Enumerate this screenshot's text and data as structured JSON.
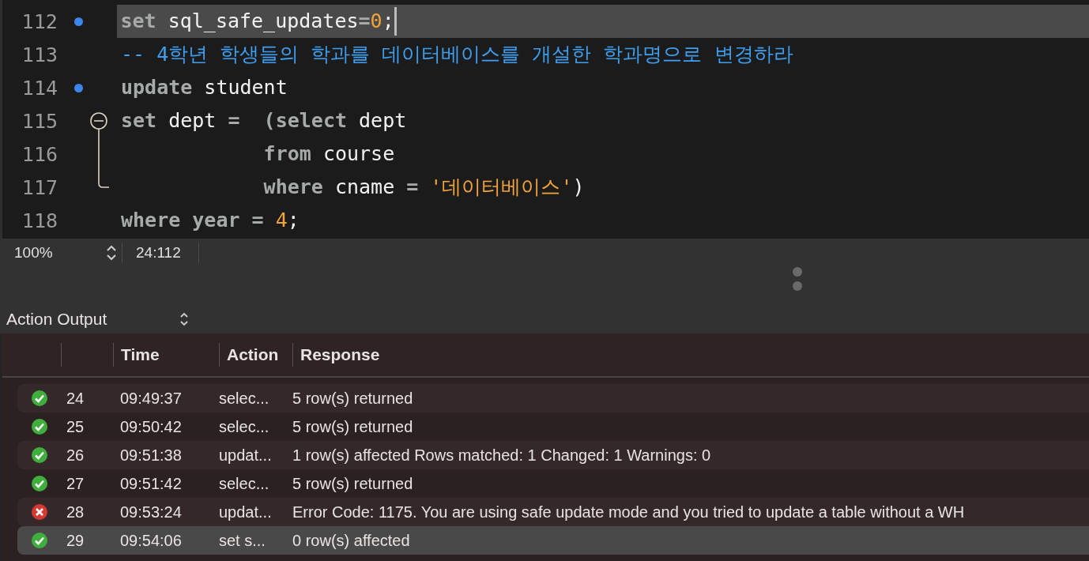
{
  "editor": {
    "lines": [
      {
        "number": "112",
        "bookmark": true,
        "highlighted": true,
        "tokens": [
          {
            "kind": "keyword",
            "text": "set"
          },
          {
            "kind": "plain",
            "text": " sql_safe_updates"
          },
          {
            "kind": "keyword",
            "text": "="
          },
          {
            "kind": "number",
            "text": "0"
          },
          {
            "kind": "plain",
            "text": ";"
          }
        ]
      },
      {
        "number": "113",
        "bookmark": false,
        "highlighted": false,
        "tokens": [
          {
            "kind": "comment",
            "text": "-- 4학년 학생들의 학과를 데이터베이스를 개설한 학과명으로 변경하라"
          }
        ]
      },
      {
        "number": "114",
        "bookmark": true,
        "highlighted": false,
        "tokens": [
          {
            "kind": "keyword",
            "text": "update"
          },
          {
            "kind": "plain",
            "text": " student"
          }
        ]
      },
      {
        "number": "115",
        "bookmark": false,
        "highlighted": false,
        "expanded": true,
        "tokens": [
          {
            "kind": "keyword",
            "text": "set"
          },
          {
            "kind": "plain",
            "text": " dept "
          },
          {
            "kind": "keyword",
            "text": "=  (select"
          },
          {
            "kind": "plain",
            "text": " dept"
          }
        ],
        "children": [
          {
            "number": "116",
            "bookmark": false,
            "highlighted": false,
            "tokens": [
              {
                "kind": "keyword",
                "text": "            from"
              },
              {
                "kind": "plain",
                "text": " course"
              }
            ]
          },
          {
            "number": "117",
            "bookmark": false,
            "highlighted": false,
            "tokens": [
              {
                "kind": "keyword",
                "text": "            where"
              },
              {
                "kind": "plain",
                "text": " cname "
              },
              {
                "kind": "keyword",
                "text": "="
              },
              {
                "kind": "string",
                "text": " '데이터베이스'"
              },
              {
                "kind": "plain",
                "text": ")"
              }
            ]
          }
        ]
      },
      {
        "number": "118",
        "bookmark": false,
        "highlighted": false,
        "tokens": [
          {
            "kind": "keyword",
            "text": "where year ="
          },
          {
            "kind": "number",
            "text": " 4"
          },
          {
            "kind": "plain",
            "text": ";"
          }
        ]
      }
    ]
  },
  "status_bar": {
    "zoom": "100%",
    "position": "24:112"
  },
  "output": {
    "title": "Action Output",
    "columns": [
      "Time",
      "Action",
      "Response"
    ],
    "rows": [
      {
        "failed": false,
        "number": "24",
        "time": "09:49:37",
        "action": "selec...",
        "response": "5 row(s) returned",
        "selected": false
      },
      {
        "failed": false,
        "number": "25",
        "time": "09:50:42",
        "action": "selec...",
        "response": "5 row(s) returned",
        "selected": false
      },
      {
        "failed": false,
        "number": "26",
        "time": "09:51:38",
        "action": "updat...",
        "response": "1 row(s) affected Rows matched: 1  Changed: 1  Warnings: 0",
        "selected": false
      },
      {
        "failed": false,
        "number": "27",
        "time": "09:51:42",
        "action": "selec...",
        "response": "5 row(s) returned",
        "selected": false
      },
      {
        "failed": true,
        "number": "28",
        "time": "09:53:24",
        "action": "updat...",
        "response": "Error Code: 1175. You are using safe update mode and you tried to update a table without a WH",
        "selected": false
      },
      {
        "failed": false,
        "number": "29",
        "time": "09:54:06",
        "action": "set s...",
        "response": "0 row(s) affected",
        "selected": true
      }
    ]
  }
}
